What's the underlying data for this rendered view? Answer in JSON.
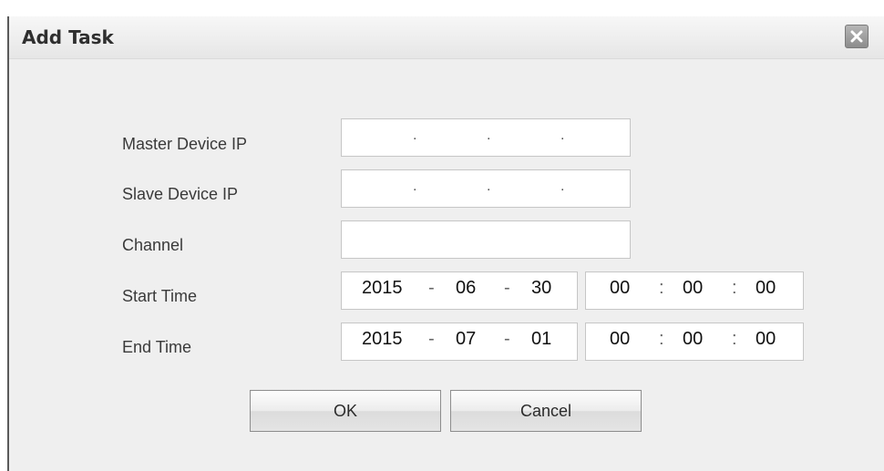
{
  "dialog": {
    "title": "Add Task"
  },
  "icons": {
    "close": "close-icon"
  },
  "form": {
    "master_ip_label": "Master Device IP",
    "slave_ip_label": "Slave Device IP",
    "channel_label": "Channel",
    "start_time_label": "Start Time",
    "end_time_label": "End Time",
    "ip_separator": ".",
    "date_separator": "-",
    "time_separator": ":",
    "channel_value": "",
    "start_date": {
      "year": "2015",
      "month": "06",
      "day": "30"
    },
    "start_time": {
      "hour": "00",
      "minute": "00",
      "second": "00"
    },
    "end_date": {
      "year": "2015",
      "month": "07",
      "day": "01"
    },
    "end_time": {
      "hour": "00",
      "minute": "00",
      "second": "00"
    }
  },
  "buttons": {
    "ok": "OK",
    "cancel": "Cancel"
  }
}
